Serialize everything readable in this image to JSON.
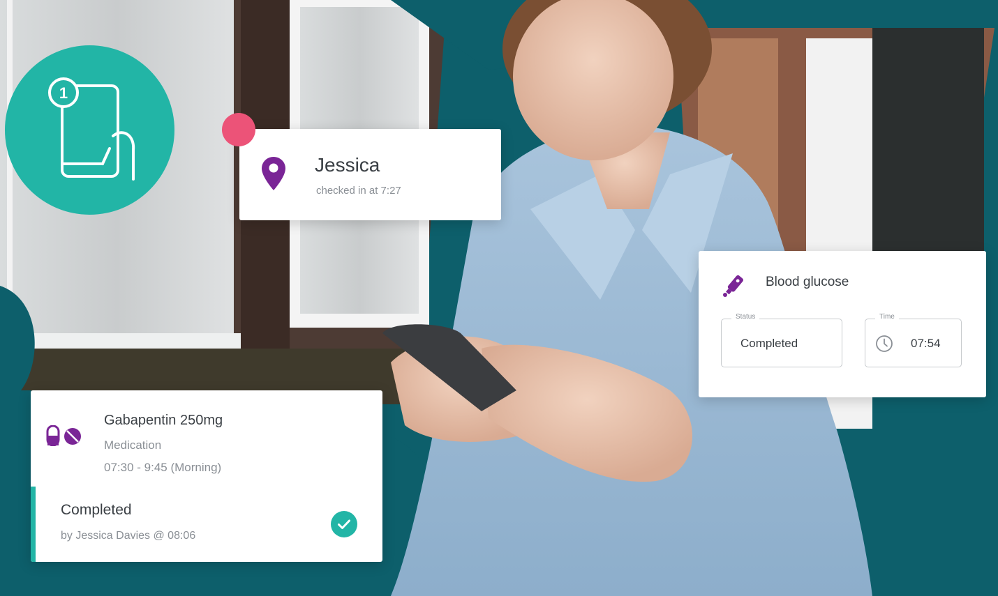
{
  "colors": {
    "brand_teal": "#22b5a6",
    "dark_teal": "#0d5f6b",
    "purple": "#7a2596",
    "accent_pink": "#ec5378"
  },
  "step_badge": {
    "number": "1",
    "icon": "phone-touch-icon"
  },
  "checkin_card": {
    "icon": "location-pin-icon",
    "name": "Jessica",
    "subtitle": "checked in at 7:27"
  },
  "glucose_card": {
    "icon": "glucose-meter-icon",
    "title": "Blood glucose",
    "status_label": "Status",
    "status_value": "Completed",
    "time_label": "Time",
    "time_value": "07:54",
    "time_icon": "clock-icon"
  },
  "medication_card": {
    "icon": "medication-pill-icon",
    "name": "Gabapentin 250mg",
    "type": "Medication",
    "time_window": "07:30 - 9:45 (Morning)",
    "status": "Completed",
    "completed_by": "by Jessica Davies @ 08:06",
    "status_icon": "check-circle-icon"
  }
}
